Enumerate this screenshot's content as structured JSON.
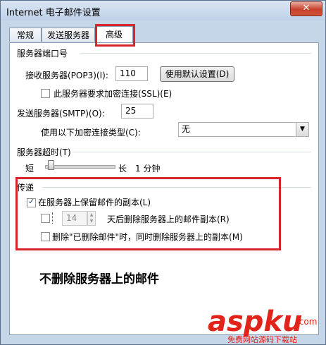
{
  "window": {
    "title": "Internet 电子邮件设置",
    "close_label": "✕"
  },
  "tabs": [
    {
      "label": "常规"
    },
    {
      "label": "发送服务器"
    },
    {
      "label": "高级"
    }
  ],
  "ports": {
    "section": "服务器端口号",
    "incoming_label": "接收服务器(POP3)(I):",
    "incoming_value": "110",
    "default_button": "使用默认设置(D)",
    "ssl_label": "此服务器要求加密连接(SSL)(E)",
    "ssl_checked": false,
    "outgoing_label": "发送服务器(SMTP)(O):",
    "outgoing_value": "25",
    "encrypt_label": "使用以下加密连接类型(C):",
    "encrypt_value": "无"
  },
  "timeout": {
    "section": "服务器超时(T)",
    "short": "短",
    "long": "长",
    "value": "1 分钟"
  },
  "delivery": {
    "section": "传递",
    "keep_copy_label": "在服务器上保留邮件的副本(L)",
    "keep_copy_checked": true,
    "remove_after_days_value": "14",
    "remove_after_days_label": "天后删除服务器上的邮件副本(R)",
    "remove_after_checked": false,
    "remove_deleted_label": "删除\"已删除邮件\"时，同时删除服务器上的副本(M)",
    "remove_deleted_checked": false
  },
  "annotation": {
    "caption": "不删除服务器上的邮件"
  },
  "watermark": {
    "logo": "aspku",
    "sub": "免费网站源码下载站",
    "sub2": ".com"
  },
  "colors": {
    "highlight_red": "#d8242c",
    "watermark_red": "#e2231a"
  }
}
